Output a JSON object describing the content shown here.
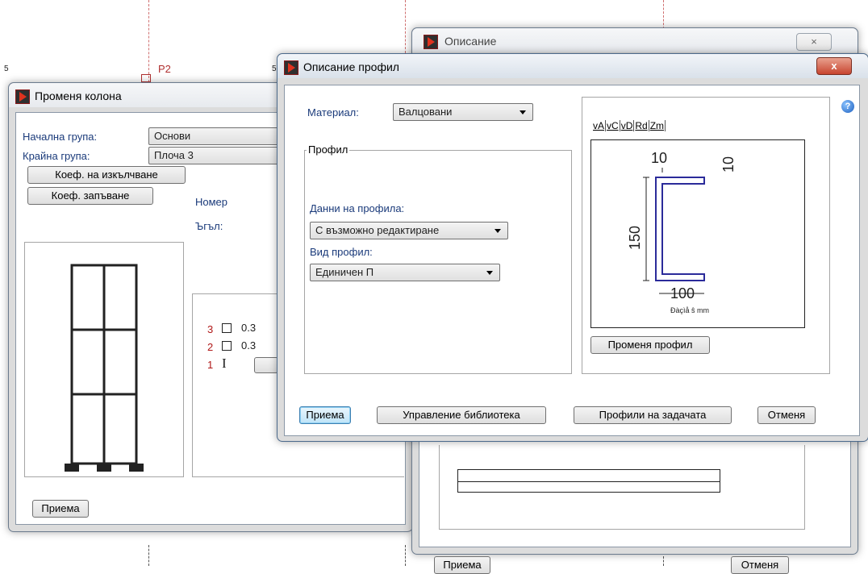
{
  "background": {
    "labels": [
      "5",
      "P2",
      "5"
    ]
  },
  "window_change_column": {
    "title": "Променя колона",
    "start_group_label": "Начална група:",
    "start_group_value": "Основи",
    "end_group_label": "Крайна група:",
    "end_group_value": "Плоча 3",
    "buckling_coef_button": "Коеф. на изкълчване",
    "lapping_coef_button": "Коеф. запъване",
    "number_label": "Номер",
    "angle_label": "Ъгъл:",
    "floor_rows": [
      {
        "index": "3",
        "value": "0.3"
      },
      {
        "index": "2",
        "value": "0.3"
      },
      {
        "index": "1",
        "value": "I"
      }
    ],
    "accept_button": "Приема"
  },
  "window_description": {
    "title": "Описание",
    "accept_button": "Приема",
    "cancel_button": "Отменя"
  },
  "window_profile_description": {
    "title": "Описание профил",
    "close_glyph": "x",
    "material_label": "Материал:",
    "material_value": "Валцовани",
    "profile_group_title": "Профил",
    "profile_data_label": "Данни на профила:",
    "profile_data_value": "С възможно редактиране",
    "profile_type_label": "Вид профил:",
    "profile_type_value": "Единичен П",
    "preview_tabs": [
      "vA",
      "vC",
      "vD",
      "Rd",
      "Zm"
    ],
    "dim_top": "10",
    "dim_flange": "10",
    "dim_height": "150",
    "dim_width": "100",
    "units_note": "Đàçìå ŝ mm",
    "change_profile_button": "Променя профил",
    "accept_button": "Приема",
    "library_button": "Управление библиотека",
    "task_profiles_button": "Профили на задачата",
    "cancel_button": "Отменя",
    "help_glyph": "?"
  }
}
